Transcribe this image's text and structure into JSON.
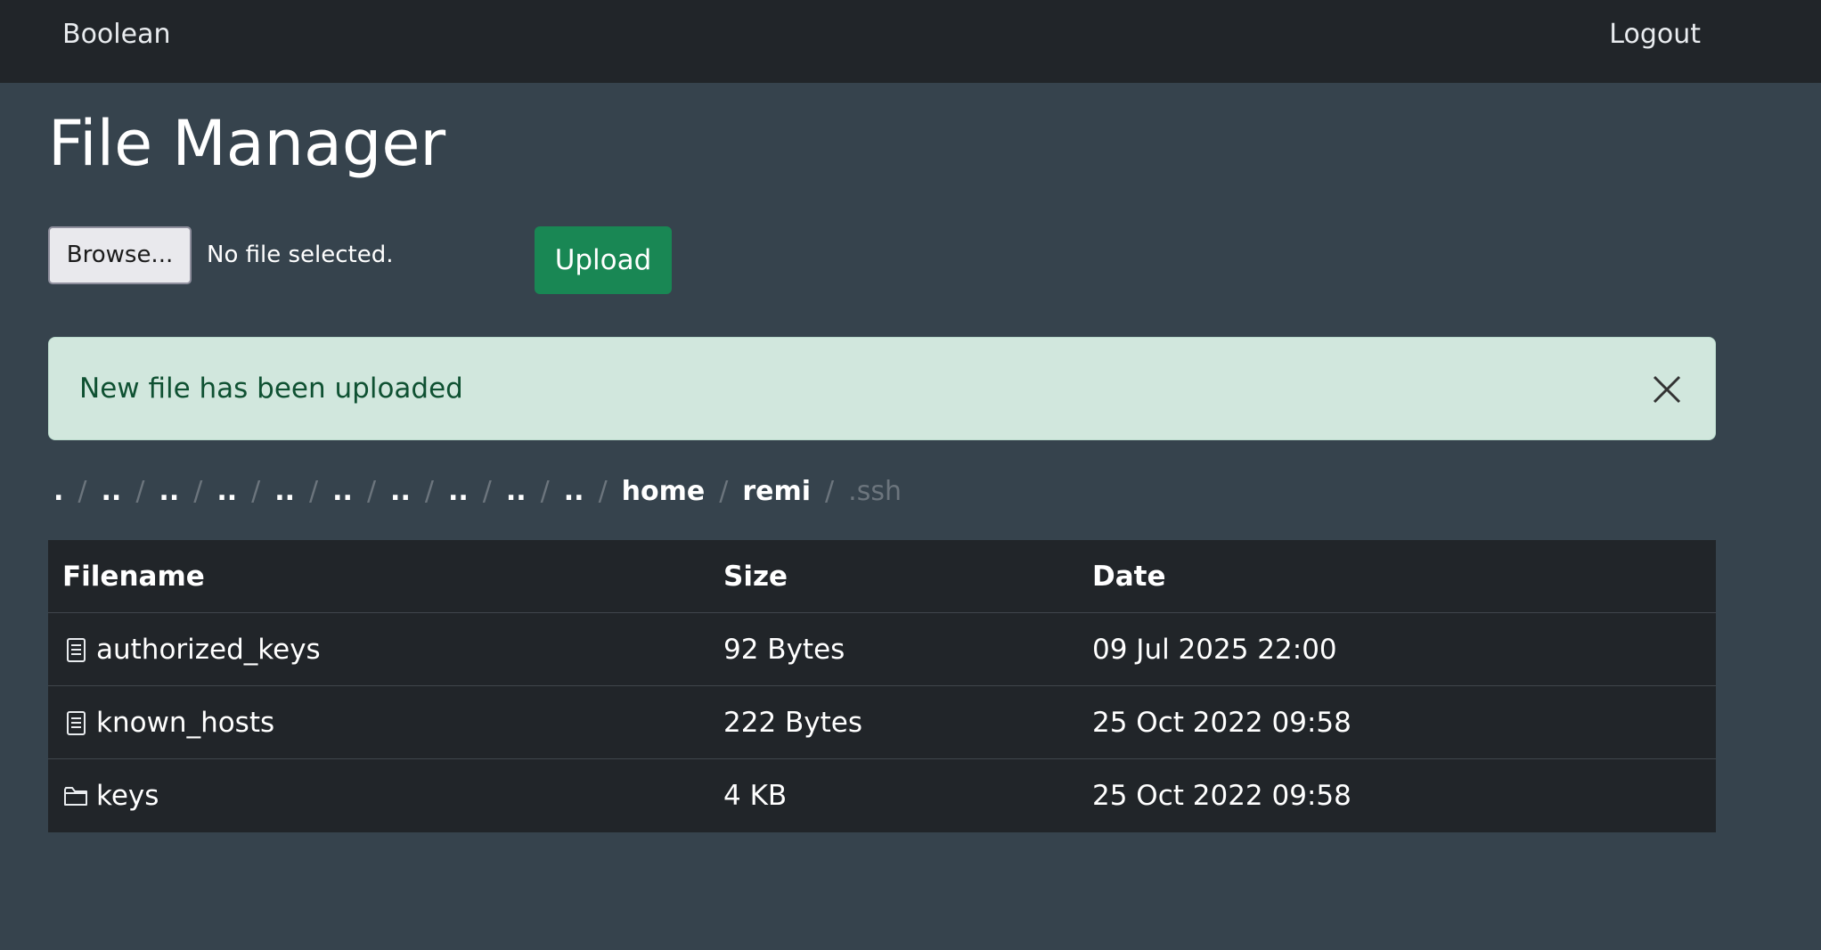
{
  "navbar": {
    "brand": "Boolean",
    "logout": "Logout"
  },
  "page": {
    "title": "File Manager"
  },
  "upload_form": {
    "browse_label": "Browse...",
    "file_status": "No file selected.",
    "upload_label": "Upload"
  },
  "alert": {
    "message": "New file has been uploaded",
    "close_icon": "close-icon"
  },
  "breadcrumb": {
    "items": [
      ".",
      "..",
      "..",
      "..",
      "..",
      "..",
      "..",
      "..",
      "..",
      "..",
      "home",
      "remi",
      ".ssh"
    ],
    "separator": "/"
  },
  "table": {
    "headers": {
      "filename": "Filename",
      "size": "Size",
      "date": "Date"
    },
    "rows": [
      {
        "icon": "file-text-icon",
        "name": "authorized_keys",
        "size": "92 Bytes",
        "date": "09 Jul 2025 22:00"
      },
      {
        "icon": "file-text-icon",
        "name": "known_hosts",
        "size": "222 Bytes",
        "date": "25 Oct 2022 09:58"
      },
      {
        "icon": "folder-icon",
        "name": "keys",
        "size": "4 KB",
        "date": "25 Oct 2022 09:58"
      }
    ]
  },
  "colors": {
    "background": "#36434d",
    "navbar": "#212529",
    "success": "#198754",
    "alert_bg": "#d1e7dd",
    "alert_text": "#0f5132"
  }
}
